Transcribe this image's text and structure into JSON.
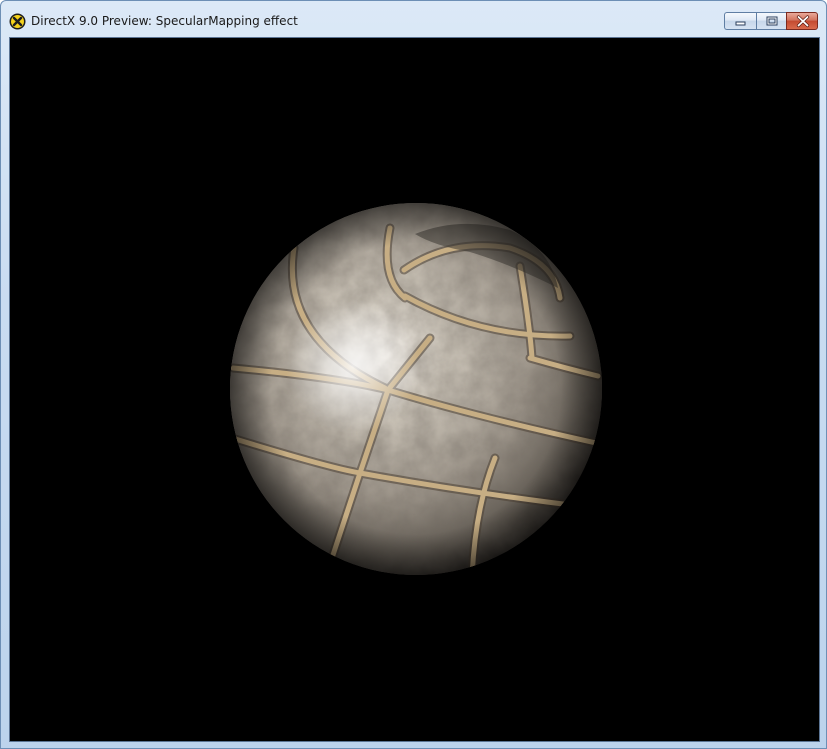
{
  "window": {
    "title": "DirectX 9.0 Preview: SpecularMapping effect",
    "app_icon": "directx-icon",
    "buttons": {
      "minimize": "minimize-icon",
      "maximize": "maximize-icon",
      "close": "close-icon"
    }
  },
  "viewport": {
    "background": "#000000",
    "object": "stone-brick-sphere"
  },
  "colors": {
    "close_button": "#c44a30",
    "frame": "#c9dcf1",
    "mortar": "#b39a74",
    "stone": "#bdb5aa"
  }
}
